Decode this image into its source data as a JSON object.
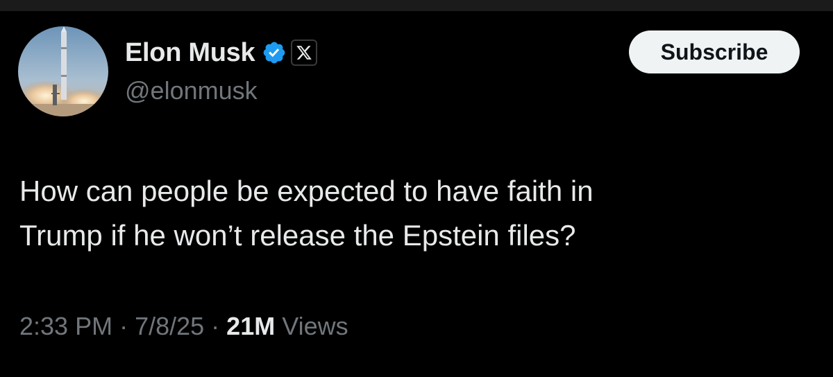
{
  "author": {
    "display_name": "Elon Musk",
    "handle": "@elonmusk",
    "verified_icon": "verified-badge-icon",
    "affiliation_icon": "x-logo-icon",
    "avatar": "rocket-launch-avatar",
    "verified_color": "#1d9bf0"
  },
  "subscribe_button": {
    "label": "Subscribe"
  },
  "tweet": {
    "text_line_1": "How can people be expected to have faith in",
    "text_line_2": "Trump if he won’t release the Epstein files?"
  },
  "meta": {
    "time": "2:33 PM",
    "separator_1": " · ",
    "date": "7/8/25",
    "separator_2": " · ",
    "views_count": "21M",
    "views_label": " Views"
  }
}
